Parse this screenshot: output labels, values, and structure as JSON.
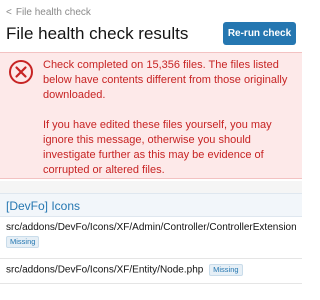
{
  "breadcrumb": {
    "label": "File health check"
  },
  "page": {
    "title": "File health check results"
  },
  "toolbar": {
    "rerun_label": "Re-run check"
  },
  "alert": {
    "icon": "error-circle-x-icon",
    "message1": "Check completed on 15,356 files. The files listed below have contents different from those originally downloaded.",
    "message2": "If you have edited these files yourself, you may ignore this message, otherwise you should investigate further as this may be evidence of corrupted or altered files."
  },
  "group": {
    "title": "[DevFo] Icons",
    "files": [
      {
        "path": "src/addons/DevFo/Icons/XF/Admin/Controller/ControllerExtension.php",
        "status": "Missing"
      },
      {
        "path": "src/addons/DevFo/Icons/XF/Entity/Node.php",
        "status": "Missing"
      }
    ]
  },
  "colors": {
    "accent": "#2577b1",
    "error": "#c72424",
    "error_bg": "#fde9e9"
  }
}
